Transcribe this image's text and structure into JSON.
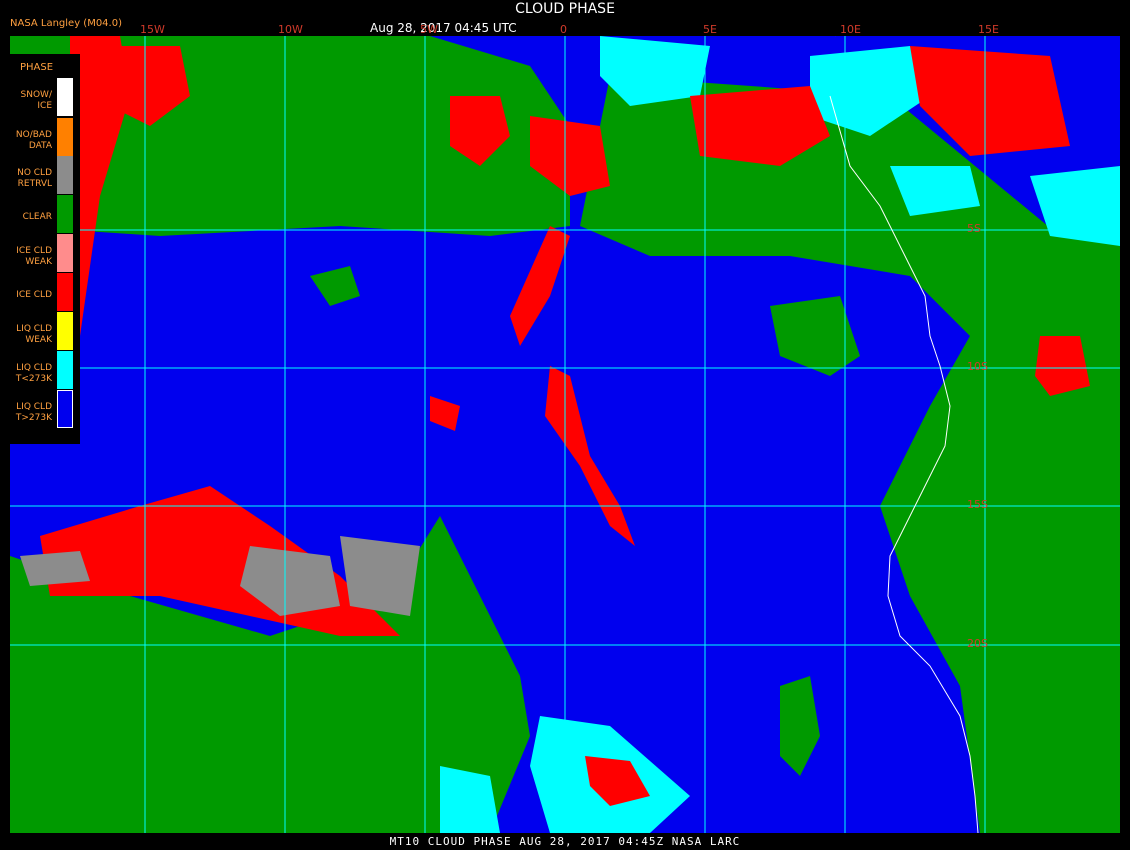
{
  "header": {
    "provider": "NASA Langley (M04.0)",
    "title": "CLOUD PHASE",
    "datetime": "Aug 28, 2017 04:45 UTC"
  },
  "legend": {
    "title": "PHASE",
    "items": [
      {
        "label_line1": "SNOW/",
        "label_line2": "ICE",
        "color": "#ffffff"
      },
      {
        "label_line1": "NO/BAD",
        "label_line2": "DATA",
        "color": "#ff8000"
      },
      {
        "label_line1": "NO CLD",
        "label_line2": "RETRVL",
        "color": "#8c8c8c"
      },
      {
        "label_line1": "CLEAR",
        "label_line2": "",
        "color": "#009a00"
      },
      {
        "label_line1": "ICE CLD",
        "label_line2": "WEAK",
        "color": "#ff8c8c"
      },
      {
        "label_line1": "ICE CLD",
        "label_line2": "",
        "color": "#ff0000"
      },
      {
        "label_line1": "LIQ CLD",
        "label_line2": "WEAK",
        "color": "#ffff00"
      },
      {
        "label_line1": "LIQ CLD",
        "label_line2": "T<273K",
        "color": "#00ffff"
      },
      {
        "label_line1": "LIQ CLD",
        "label_line2": "T>273K",
        "color": "#0000ee"
      }
    ]
  },
  "map": {
    "lon_labels": [
      "15W",
      "10W",
      "5W",
      "0",
      "5E",
      "10E",
      "15E"
    ],
    "lat_labels": [
      "5S",
      "10S",
      "15S",
      "20S"
    ],
    "grid_color": "#00ffff",
    "coast_color": "#ffffff"
  },
  "footer": {
    "text": "MT10  CLOUD PHASE  AUG 28, 2017 04:45Z  NASA LARC"
  }
}
